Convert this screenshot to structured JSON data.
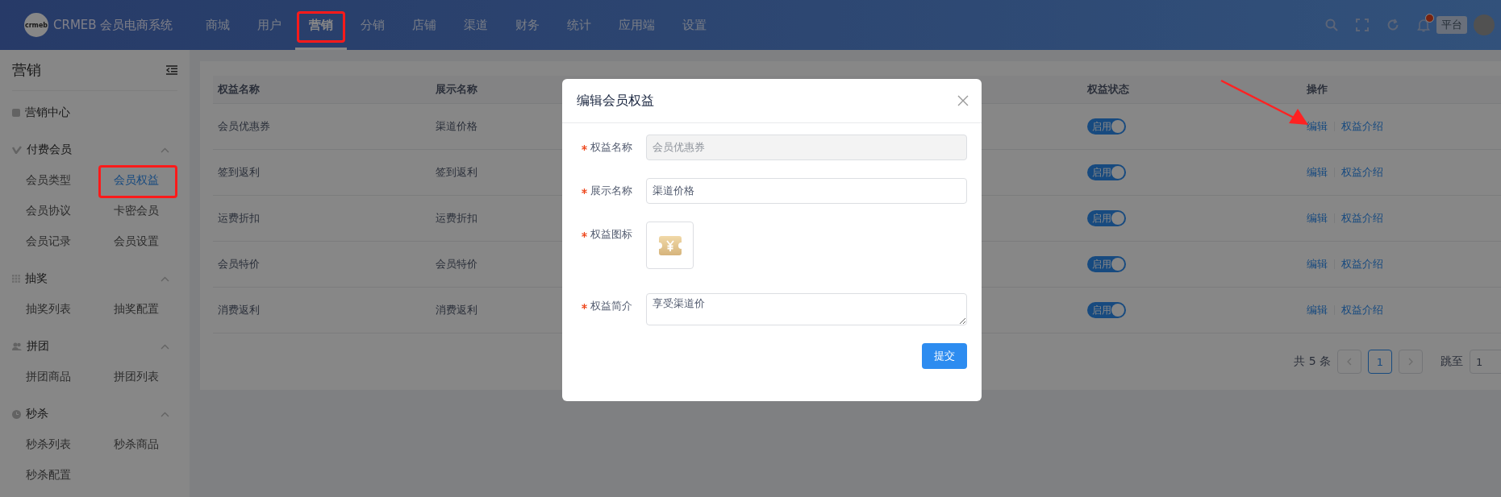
{
  "header": {
    "logo_text": "crmeb",
    "title": "CRMEB 会员电商系统",
    "nav": [
      {
        "label": "商城",
        "selected": false,
        "highlighted": false
      },
      {
        "label": "用户",
        "selected": false,
        "highlighted": false
      },
      {
        "label": "营销",
        "selected": true,
        "highlighted": true
      },
      {
        "label": "分销",
        "selected": false,
        "highlighted": false
      },
      {
        "label": "店铺",
        "selected": false,
        "highlighted": false
      },
      {
        "label": "渠道",
        "selected": false,
        "highlighted": false
      },
      {
        "label": "财务",
        "selected": false,
        "highlighted": false
      },
      {
        "label": "统计",
        "selected": false,
        "highlighted": false
      },
      {
        "label": "应用端",
        "selected": false,
        "highlighted": false
      },
      {
        "label": "设置",
        "selected": false,
        "highlighted": false
      }
    ],
    "notification_badge": true,
    "tag": "平台"
  },
  "sidebar": {
    "title": "营销",
    "items": [
      {
        "kind": "link",
        "label": "营销中心"
      },
      {
        "kind": "group",
        "label": "付费会员",
        "expanded": true,
        "children": [
          {
            "label": "会员类型",
            "selected": false,
            "highlighted": false
          },
          {
            "label": "会员权益",
            "selected": true,
            "highlighted": true
          },
          {
            "label": "会员协议",
            "selected": false,
            "highlighted": false
          },
          {
            "label": "卡密会员",
            "selected": false,
            "highlighted": false
          },
          {
            "label": "会员记录",
            "selected": false,
            "highlighted": false
          },
          {
            "label": "会员设置",
            "selected": false,
            "highlighted": false
          }
        ]
      },
      {
        "kind": "group",
        "label": "抽奖",
        "expanded": true,
        "children": [
          {
            "label": "抽奖列表",
            "selected": false,
            "highlighted": false
          },
          {
            "label": "抽奖配置",
            "selected": false,
            "highlighted": false
          }
        ]
      },
      {
        "kind": "group",
        "label": "拼团",
        "expanded": true,
        "children": [
          {
            "label": "拼团商品",
            "selected": false,
            "highlighted": false
          },
          {
            "label": "拼团列表",
            "selected": false,
            "highlighted": false
          }
        ]
      },
      {
        "kind": "group",
        "label": "秒杀",
        "expanded": true,
        "children": [
          {
            "label": "秒杀列表",
            "selected": false,
            "highlighted": false
          },
          {
            "label": "秒杀商品",
            "selected": false,
            "highlighted": false
          },
          {
            "label": "秒杀配置",
            "selected": false,
            "highlighted": false
          }
        ]
      }
    ]
  },
  "table": {
    "columns": [
      "权益名称",
      "展示名称",
      "权益状态",
      "操作"
    ],
    "rows": [
      {
        "name": "会员优惠券",
        "display_name": "渠道价格",
        "status": {
          "label": "启用",
          "on": true
        },
        "actions": [
          "编辑",
          "权益介绍"
        ]
      },
      {
        "name": "签到返利",
        "display_name": "签到返利",
        "status": {
          "label": "启用",
          "on": true
        },
        "actions": [
          "编辑",
          "权益介绍"
        ]
      },
      {
        "name": "运费折扣",
        "display_name": "运费折扣",
        "status": {
          "label": "启用",
          "on": true
        },
        "actions": [
          "编辑",
          "权益介绍"
        ]
      },
      {
        "name": "会员特价",
        "display_name": "会员特价",
        "status": {
          "label": "启用",
          "on": true
        },
        "actions": [
          "编辑",
          "权益介绍"
        ]
      },
      {
        "name": "消费返利",
        "display_name": "消费返利",
        "status": {
          "label": "启用",
          "on": true
        },
        "actions": [
          "编辑",
          "权益介绍"
        ]
      }
    ]
  },
  "pagination": {
    "total": "共 5 条",
    "pages": [
      {
        "label": "1",
        "selected": true
      }
    ],
    "jump_label": "跳至",
    "jump_value": "1"
  },
  "dialog": {
    "title": "编辑会员权益",
    "fields": [
      {
        "kind": "text",
        "label": "权益名称",
        "required": true,
        "value": "会员优惠券",
        "disabled": true
      },
      {
        "kind": "text",
        "label": "展示名称",
        "required": true,
        "value": "渠道价格",
        "disabled": false
      },
      {
        "kind": "image",
        "label": "权益图标",
        "required": true
      },
      {
        "kind": "textarea",
        "label": "权益简介",
        "required": true,
        "value": "享受渠道价"
      }
    ],
    "submit": "提交"
  }
}
